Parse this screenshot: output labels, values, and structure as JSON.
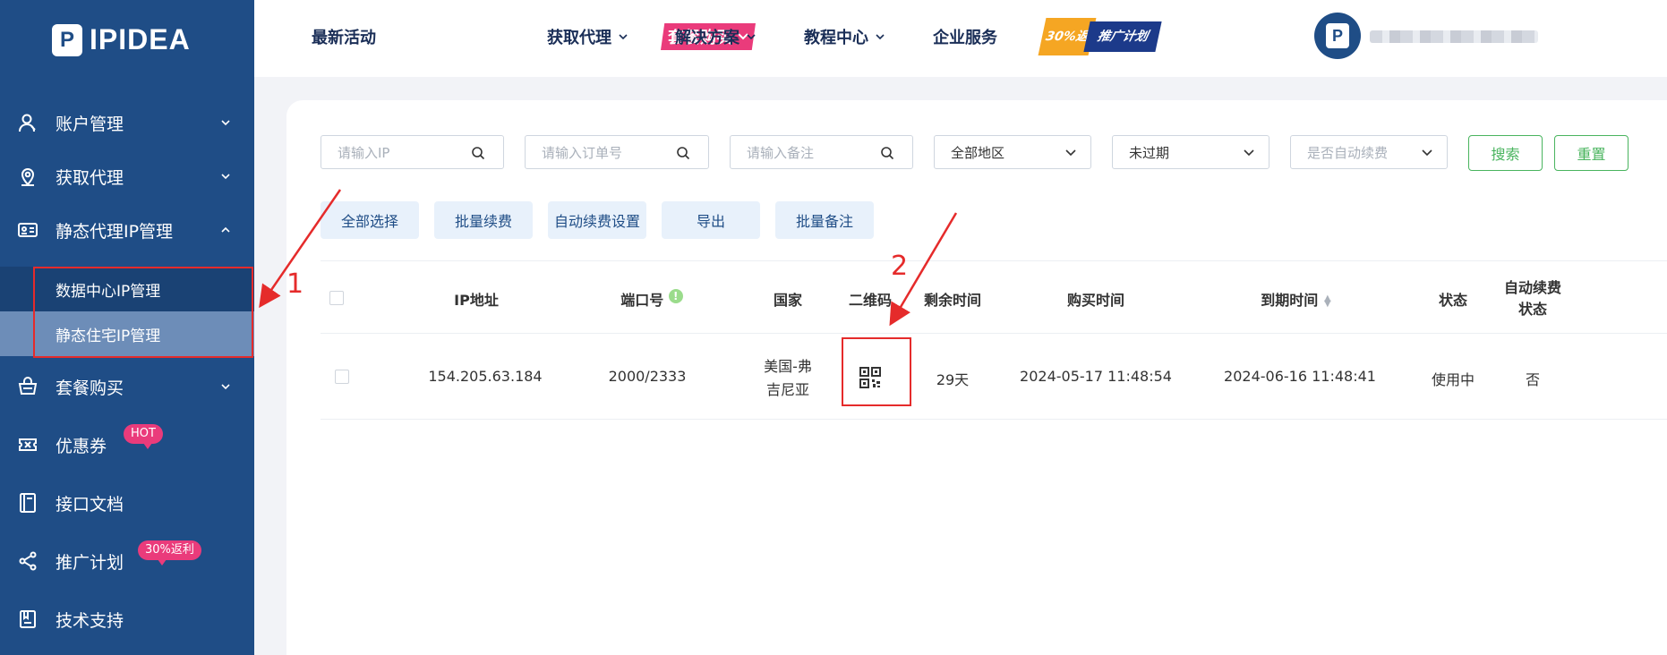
{
  "brand": {
    "logo_mark": "P",
    "name": "IPIDEA"
  },
  "sidebar": {
    "items": [
      {
        "label": "账户管理"
      },
      {
        "label": "获取代理"
      },
      {
        "label": "静态代理IP管理"
      },
      {
        "label": "套餐购买"
      },
      {
        "label": "优惠券",
        "badge": "HOT"
      },
      {
        "label": "接口文档"
      },
      {
        "label": "推广计划",
        "badge": "30%返利"
      },
      {
        "label": "技术支持"
      }
    ],
    "sub_items": [
      {
        "label": "数据中心IP管理"
      },
      {
        "label": "静态住宅IP管理"
      }
    ]
  },
  "topnav": {
    "items": [
      "最新活动",
      "套餐购买",
      "获取代理",
      "解决方案",
      "教程中心",
      "企业服务"
    ],
    "promo": {
      "left": "30%返",
      "right": "推广计划"
    }
  },
  "filters": {
    "ip_placeholder": "请输入IP",
    "order_placeholder": "请输入订单号",
    "note_placeholder": "请输入备注",
    "region_value": "全部地区",
    "expiry_value": "未过期",
    "auto_renew_placeholder": "是否自动续费",
    "search_label": "搜索",
    "reset_label": "重置"
  },
  "actions": [
    "全部选择",
    "批量续费",
    "自动续费设置",
    "导出",
    "批量备注"
  ],
  "table": {
    "headers": [
      "IP地址",
      "端口号",
      "国家",
      "二维码",
      "剩余时间",
      "购买时间",
      "到期时间",
      "状态",
      "自动续费",
      "状态"
    ],
    "rows": [
      {
        "ip": "154.205.63.184",
        "port": "2000/2333",
        "country_line1": "美国-弗",
        "country_line2": "吉尼亚",
        "remaining": "29天",
        "purchased": "2024-05-17 11:48:54",
        "expires": "2024-06-16 11:48:41",
        "status": "使用中",
        "auto_renew": "否"
      }
    ]
  },
  "annotations": {
    "one": "1",
    "two": "2"
  },
  "colors": {
    "sidebar": "#1f4d86",
    "accent_pink": "#ea3b7b",
    "green": "#49b45e",
    "highlight": "#e52b2b"
  }
}
